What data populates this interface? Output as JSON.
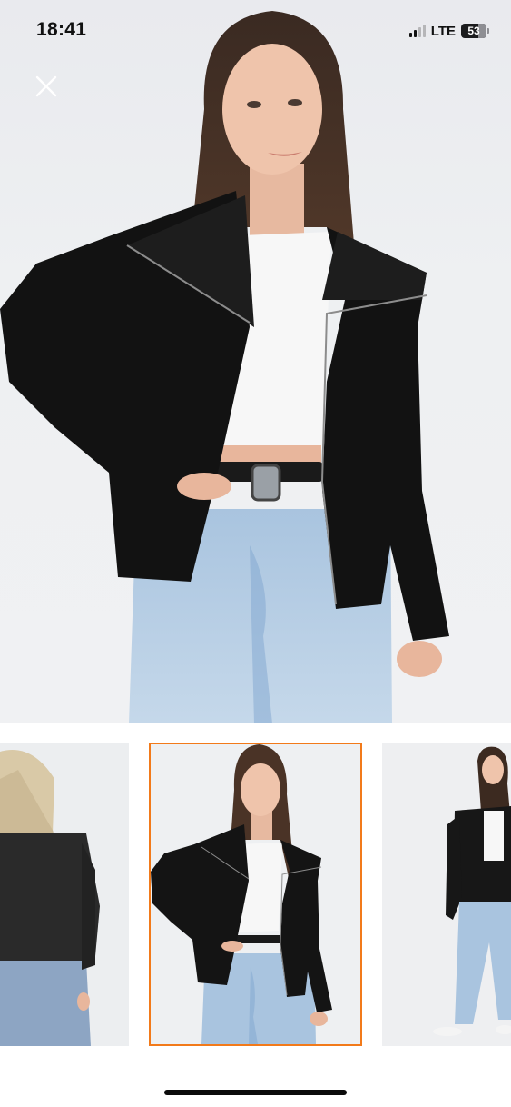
{
  "status_bar": {
    "time": "18:41",
    "network": "LTE",
    "battery": "53",
    "signal_bars_active": 2,
    "signal_bars_total": 4
  },
  "hero": {
    "close_icon": "close-icon"
  },
  "thumbnails": [
    {
      "view": "back",
      "selected": false
    },
    {
      "view": "front",
      "selected": true
    },
    {
      "view": "full-body",
      "selected": false
    }
  ],
  "colors": {
    "selected_border": "#f27a1a",
    "background": "#ffffff"
  }
}
